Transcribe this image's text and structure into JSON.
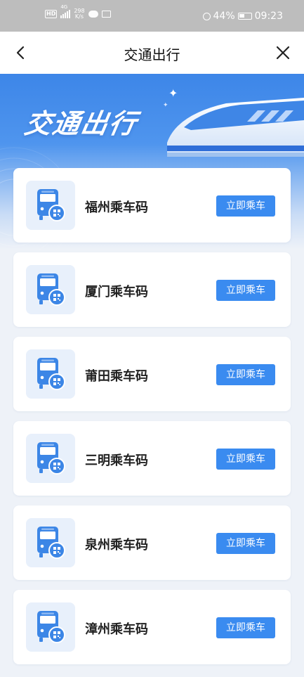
{
  "status_bar": {
    "hd": "HD",
    "network": "4G",
    "speed_value": "298",
    "speed_unit": "K/s",
    "battery": "44%",
    "time": "09:23"
  },
  "nav": {
    "title": "交通出行",
    "back_icon": "chevron-left",
    "close_icon": "close-x"
  },
  "banner": {
    "title": "交通出行",
    "illustration": "high-speed-train"
  },
  "colors": {
    "accent": "#3a8bf0",
    "banner_blue": "#3d86e8",
    "page_bg": "#eef2f8"
  },
  "cards": [
    {
      "name": "福州乘车码",
      "button": "立即乘车",
      "icon": "bus-qr-icon"
    },
    {
      "name": "厦门乘车码",
      "button": "立即乘车",
      "icon": "bus-qr-icon"
    },
    {
      "name": "莆田乘车码",
      "button": "立即乘车",
      "icon": "bus-qr-icon"
    },
    {
      "name": "三明乘车码",
      "button": "立即乘车",
      "icon": "bus-qr-icon"
    },
    {
      "name": "泉州乘车码",
      "button": "立即乘车",
      "icon": "bus-qr-icon"
    },
    {
      "name": "漳州乘车码",
      "button": "立即乘车",
      "icon": "bus-qr-icon"
    }
  ]
}
